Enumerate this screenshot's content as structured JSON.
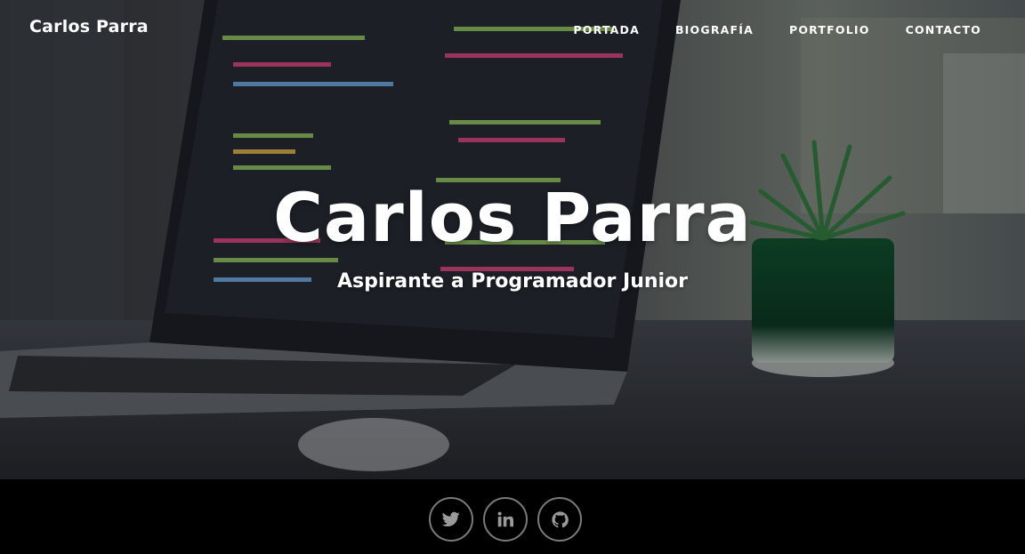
{
  "header": {
    "brand": "Carlos Parra",
    "nav": [
      {
        "label": "PORTADA"
      },
      {
        "label": "BIOGRAFÍA"
      },
      {
        "label": "PORTFOLIO"
      },
      {
        "label": "CONTACTO"
      }
    ]
  },
  "hero": {
    "title": "Carlos Parra",
    "subtitle": "Aspirante a Programador Junior"
  },
  "footer": {
    "social": [
      {
        "icon": "twitter-icon"
      },
      {
        "icon": "linkedin-icon"
      },
      {
        "icon": "github-icon"
      }
    ]
  },
  "colors": {
    "text": "#ffffff",
    "footer_bg": "#000000",
    "social_border": "#7a7a7a",
    "social_icon": "#9a9a9a",
    "code_green": "#8fc25e",
    "code_pink": "#d9457a",
    "plant_green": "#1f7a3c"
  }
}
